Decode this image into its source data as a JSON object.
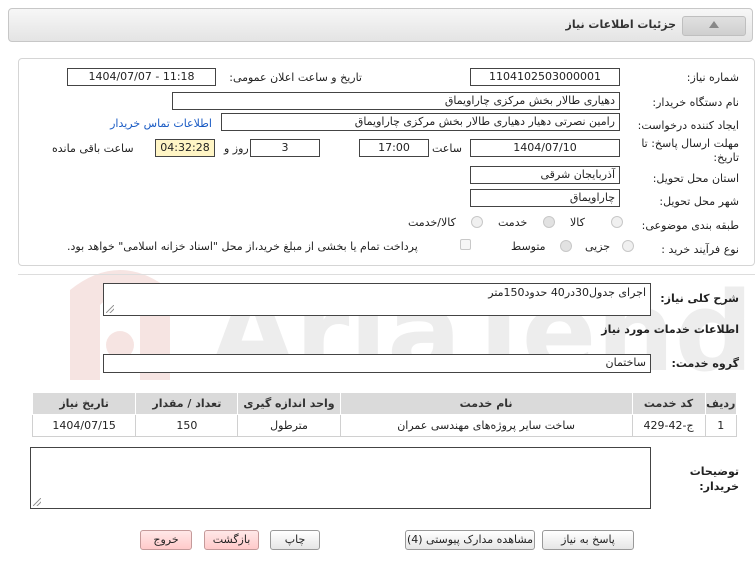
{
  "header": {
    "title": "جزئیات اطلاعات نیاز"
  },
  "fields": {
    "need_number_label": "شماره نیاز:",
    "need_number": "1104102503000001",
    "announce_label": "تاریخ و ساعت اعلان عمومی:",
    "announce_value": "1404/07/07 - 11:18",
    "buyer_org_label": "نام دستگاه خریدار:",
    "buyer_org": "دهیاری طالار  بخش مرکزی چاراویماق",
    "creator_label": "ایجاد کننده درخواست:",
    "creator": "رامین نصرتی دهیار دهیاری طالار  بخش مرکزی چاراویماق",
    "contact_link": "اطلاعات تماس خریدار",
    "deadline_label": "مهلت ارسال پاسخ: تا",
    "deadline_label2": "تاریخ:",
    "deadline_date": "1404/07/10",
    "time_label": "ساعت",
    "deadline_time": "17:00",
    "days_value": "3",
    "days_label": "روز و",
    "remaining_time": "04:32:28",
    "remaining_label": "ساعت باقی مانده",
    "province_label": "استان محل تحویل:",
    "province": "آذربایجان شرقی",
    "city_label": "شهر محل تحویل:",
    "city": "چاراویماق",
    "category_label": "طبقه بندی موضوعی:",
    "category_options": [
      "کالا",
      "خدمت",
      "کالا/خدمت"
    ],
    "purchase_type_label": "نوع فرآیند خرید :",
    "purchase_options": [
      "جزیی",
      "متوسط"
    ],
    "treasury_note": "پرداخت تمام یا بخشی از مبلغ خرید،از محل \"اسناد خزانه اسلامی\" خواهد بود."
  },
  "description": {
    "label": "شرح کلی نیاز:",
    "value": "اجرای جدول30در40 حدود150متر"
  },
  "services": {
    "section_title": "اطلاعات خدمات مورد نیاز",
    "group_label": "گروه خدمت:",
    "group_value": "ساختمان",
    "columns": [
      "ردیف",
      "کد خدمت",
      "نام خدمت",
      "واحد اندازه گیری",
      "تعداد / مقدار",
      "تاریخ نیاز"
    ],
    "rows": [
      [
        "1",
        "ج-42-429",
        "ساخت سایر پروژه‌های مهندسی عمران",
        "مترطول",
        "150",
        "1404/07/15"
      ]
    ]
  },
  "buyer_notes": {
    "label": "توضیحات\nخریدار:",
    "value": ""
  },
  "buttons": {
    "reply": "پاسخ به نیاز",
    "attachments": "مشاهده مدارک پیوستی (4)",
    "print": "چاپ",
    "back": "بازگشت",
    "exit": "خروج"
  },
  "watermark": "AriaTender.net",
  "colors": {
    "accent_link": "#1a5bc4",
    "highlight": "#fff5c5",
    "watermark_red": "#c0392b"
  }
}
